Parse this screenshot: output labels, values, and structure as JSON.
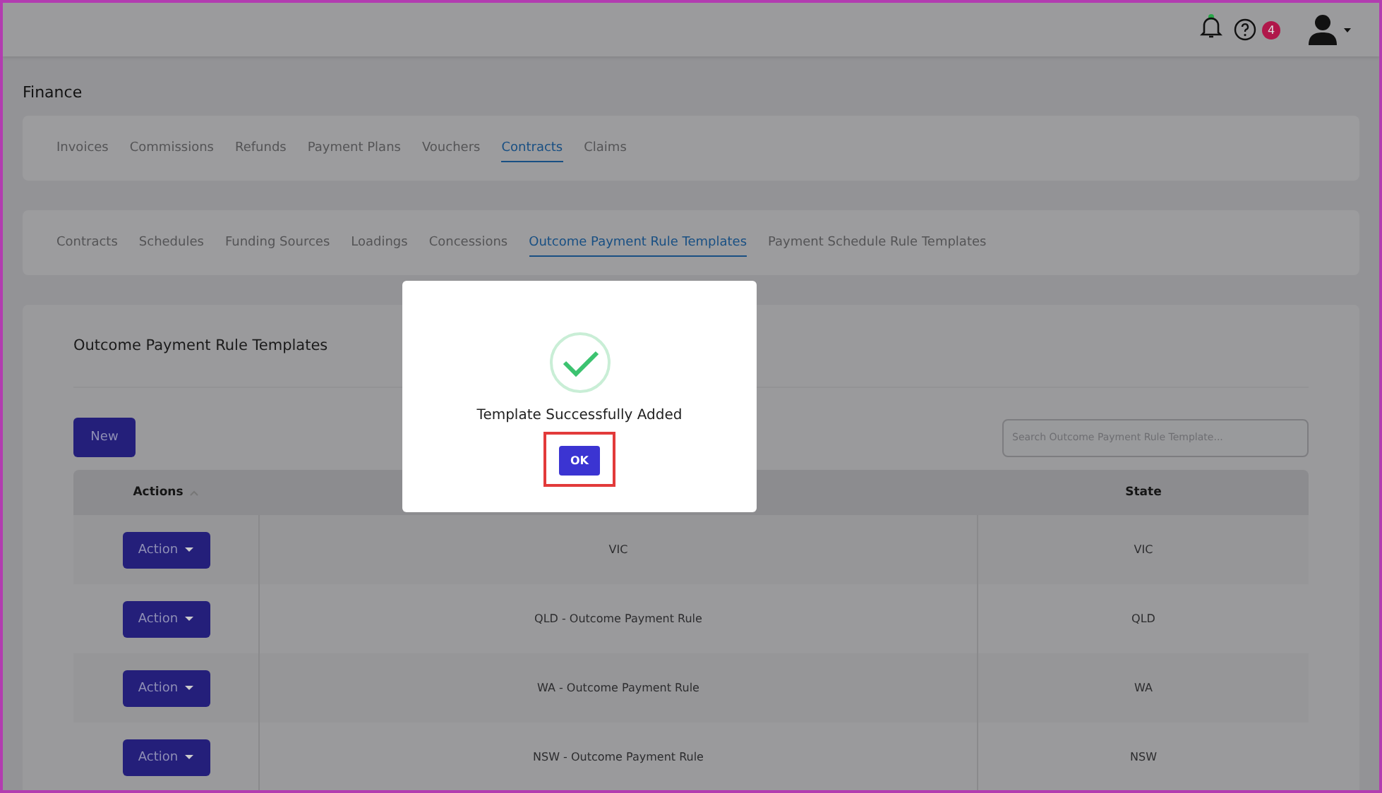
{
  "header": {
    "help_badge": "4"
  },
  "page_title": "Finance",
  "tabs": [
    {
      "label": "Invoices",
      "selected": false
    },
    {
      "label": "Commissions",
      "selected": false
    },
    {
      "label": "Refunds",
      "selected": false
    },
    {
      "label": "Payment Plans",
      "selected": false
    },
    {
      "label": "Vouchers",
      "selected": false
    },
    {
      "label": "Contracts",
      "selected": true
    },
    {
      "label": "Claims",
      "selected": false
    }
  ],
  "sub_tabs": [
    {
      "label": "Contracts",
      "selected": false
    },
    {
      "label": "Schedules",
      "selected": false
    },
    {
      "label": "Funding Sources",
      "selected": false
    },
    {
      "label": "Loadings",
      "selected": false
    },
    {
      "label": "Concessions",
      "selected": false
    },
    {
      "label": "Outcome Payment Rule Templates",
      "selected": true
    },
    {
      "label": "Payment Schedule Rule Templates",
      "selected": false
    }
  ],
  "card": {
    "title": "Outcome Payment Rule Templates",
    "new_button": "New",
    "search": {
      "placeholder": "Search Outcome Payment Rule Template..."
    }
  },
  "table": {
    "columns": {
      "actions": "Actions",
      "state": "State"
    },
    "rows": [
      {
        "action": "Action",
        "name": "VIC",
        "state": "VIC"
      },
      {
        "action": "Action",
        "name": "QLD - Outcome Payment Rule",
        "state": "QLD"
      },
      {
        "action": "Action",
        "name": "WA - Outcome Payment Rule",
        "state": "WA"
      },
      {
        "action": "Action",
        "name": "NSW - Outcome Payment Rule",
        "state": "NSW"
      }
    ]
  },
  "dialog": {
    "message": "Template Successfully Added",
    "button": "OK",
    "highlighted": true
  }
}
